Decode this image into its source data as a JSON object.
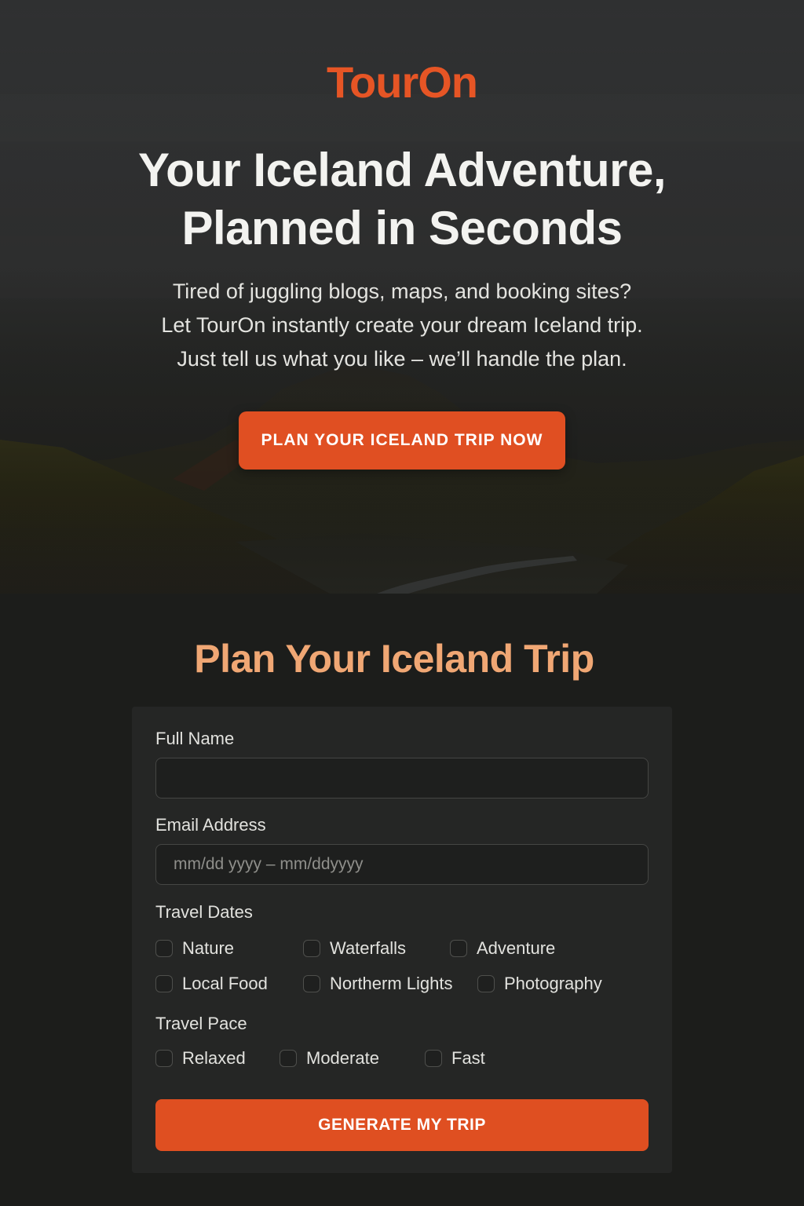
{
  "brand": {
    "name": "TourOn"
  },
  "hero": {
    "headline_lines": [
      "Your Iceland Adventure,",
      "Planned in Seconds"
    ],
    "subtitle_lines": [
      "Tired of juggling blogs, maps, and booking sites?",
      "Let TourOn instantly create your dream Iceland trip.",
      "Just tell us what you like – we’ll handle the plan."
    ],
    "cta_label": "PLAN YOUR ICELAND TRIP NOW"
  },
  "form": {
    "title": "Plan Your Iceland Trip",
    "full_name": {
      "label": "Full Name",
      "value": "",
      "placeholder": ""
    },
    "email": {
      "label": "Email Address",
      "value": "",
      "placeholder": "mm/dd yyyy – mm/ddyyyy"
    },
    "travel_dates": {
      "label": "Travel Dates",
      "options": [
        {
          "label": "Nature",
          "checked": false
        },
        {
          "label": "Waterfalls",
          "checked": false
        },
        {
          "label": "Adventure",
          "checked": false
        },
        {
          "label": "Local Food",
          "checked": false
        },
        {
          "label": "Northerm Lights",
          "checked": false
        },
        {
          "label": "Photography",
          "checked": false
        }
      ]
    },
    "travel_pace": {
      "label": "Travel Pace",
      "options": [
        {
          "label": "Relaxed",
          "checked": false
        },
        {
          "label": "Moderate",
          "checked": false
        },
        {
          "label": "Fast",
          "checked": false
        }
      ]
    },
    "submit_label": "GENERATE MY TRIP"
  },
  "colors": {
    "accent": "#e04f22",
    "brand_text": "#e65525",
    "section_title": "#f0a774",
    "background": "#1c1d1b",
    "card": "#252625"
  }
}
